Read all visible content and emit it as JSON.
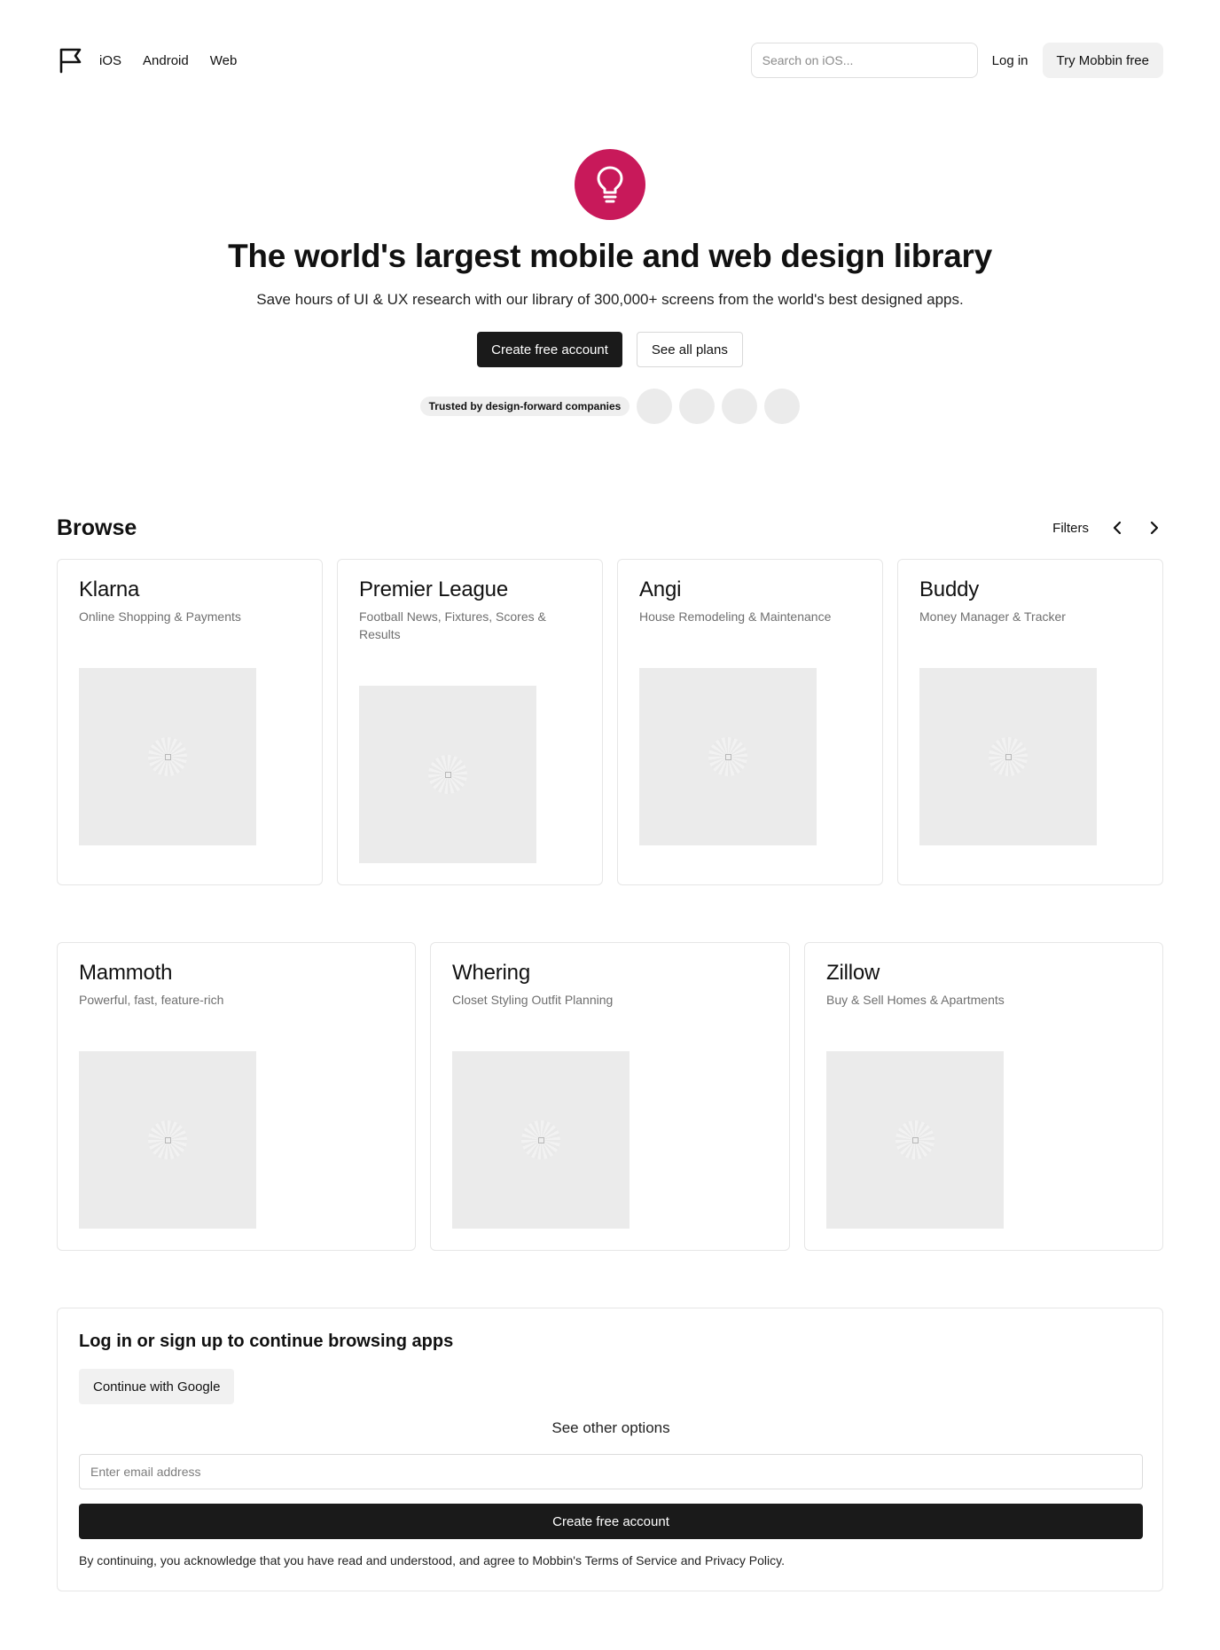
{
  "header": {
    "logo_icon": "flag-icon",
    "nav": [
      "iOS",
      "Android",
      "Web"
    ],
    "search_placeholder": "Search on iOS...",
    "login_label": "Log in",
    "try_label": "Try Mobbin free"
  },
  "hero": {
    "icon": "lightbulb-icon",
    "icon_color": "#c8195a",
    "title": "The world's largest mobile and web design library",
    "subtitle": "Save hours of UI & UX research with our library of 300,000+ screens from the world's best designed apps.",
    "primary_cta": "Create free account",
    "secondary_cta": "See all plans",
    "trusted_label": "Trusted by design-forward companies"
  },
  "browse": {
    "title": "Browse",
    "filters_label": "Filters",
    "apps": [
      {
        "name": "Klarna",
        "desc": "Online Shopping & Payments"
      },
      {
        "name": "Premier League",
        "desc": "Football News, Fixtures, Scores & Results"
      },
      {
        "name": "Angi",
        "desc": "House Remodeling & Maintenance"
      },
      {
        "name": "Buddy",
        "desc": "Money Manager & Tracker"
      },
      {
        "name": "Mammoth",
        "desc": "Powerful, fast, feature-rich"
      },
      {
        "name": "Whering",
        "desc": "Closet Styling Outfit Planning"
      },
      {
        "name": "Zillow",
        "desc": "Buy & Sell Homes & Apartments"
      }
    ]
  },
  "signup": {
    "title": "Log in or sign up to continue browsing apps",
    "google_label": "Continue with Google",
    "other_options": "See other options",
    "email_placeholder": "Enter email address",
    "create_label": "Create free account",
    "legal": "By continuing, you acknowledge that you have read and understood, and agree to Mobbin's Terms of Service and Privacy Policy."
  }
}
